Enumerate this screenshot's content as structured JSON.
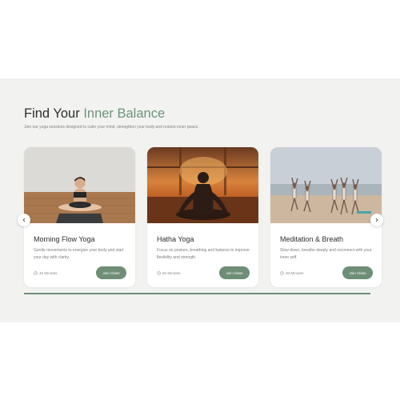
{
  "section": {
    "title_prefix": "Find Your ",
    "title_accent": "Inner Balance",
    "subtitle": "Join our yoga sessions designed to calm your mind, strengthen your body and restore inner peace."
  },
  "colors": {
    "accent": "#6e8e77",
    "background": "#f2f3f0",
    "card": "#ffffff",
    "title": "#2b2f2c"
  },
  "cards": [
    {
      "image": "woman meditating cross-legged on yoga mat",
      "title": "Morning Flow Yoga",
      "description": "Gentle movements to energize your body and start your day with clarity.",
      "duration": "45 Minutes",
      "button": "Join Class"
    },
    {
      "image": "silhouette meditating at sunset",
      "title": "Hatha Yoga",
      "description": "Focus on posture, breathing and balance to improve flexibility and strength.",
      "duration": "60 Minutes",
      "button": "Join Class"
    },
    {
      "image": "group doing yoga pose on the beach",
      "title": "Meditation & Breath",
      "description": "Slow down, breathe deeply and reconnect with your inner self.",
      "duration": "30 Minutes",
      "button": "Join Class"
    }
  ],
  "carousel": {
    "prev_icon": "chevron-left-icon",
    "next_icon": "chevron-right-icon",
    "progress": 1.0
  }
}
